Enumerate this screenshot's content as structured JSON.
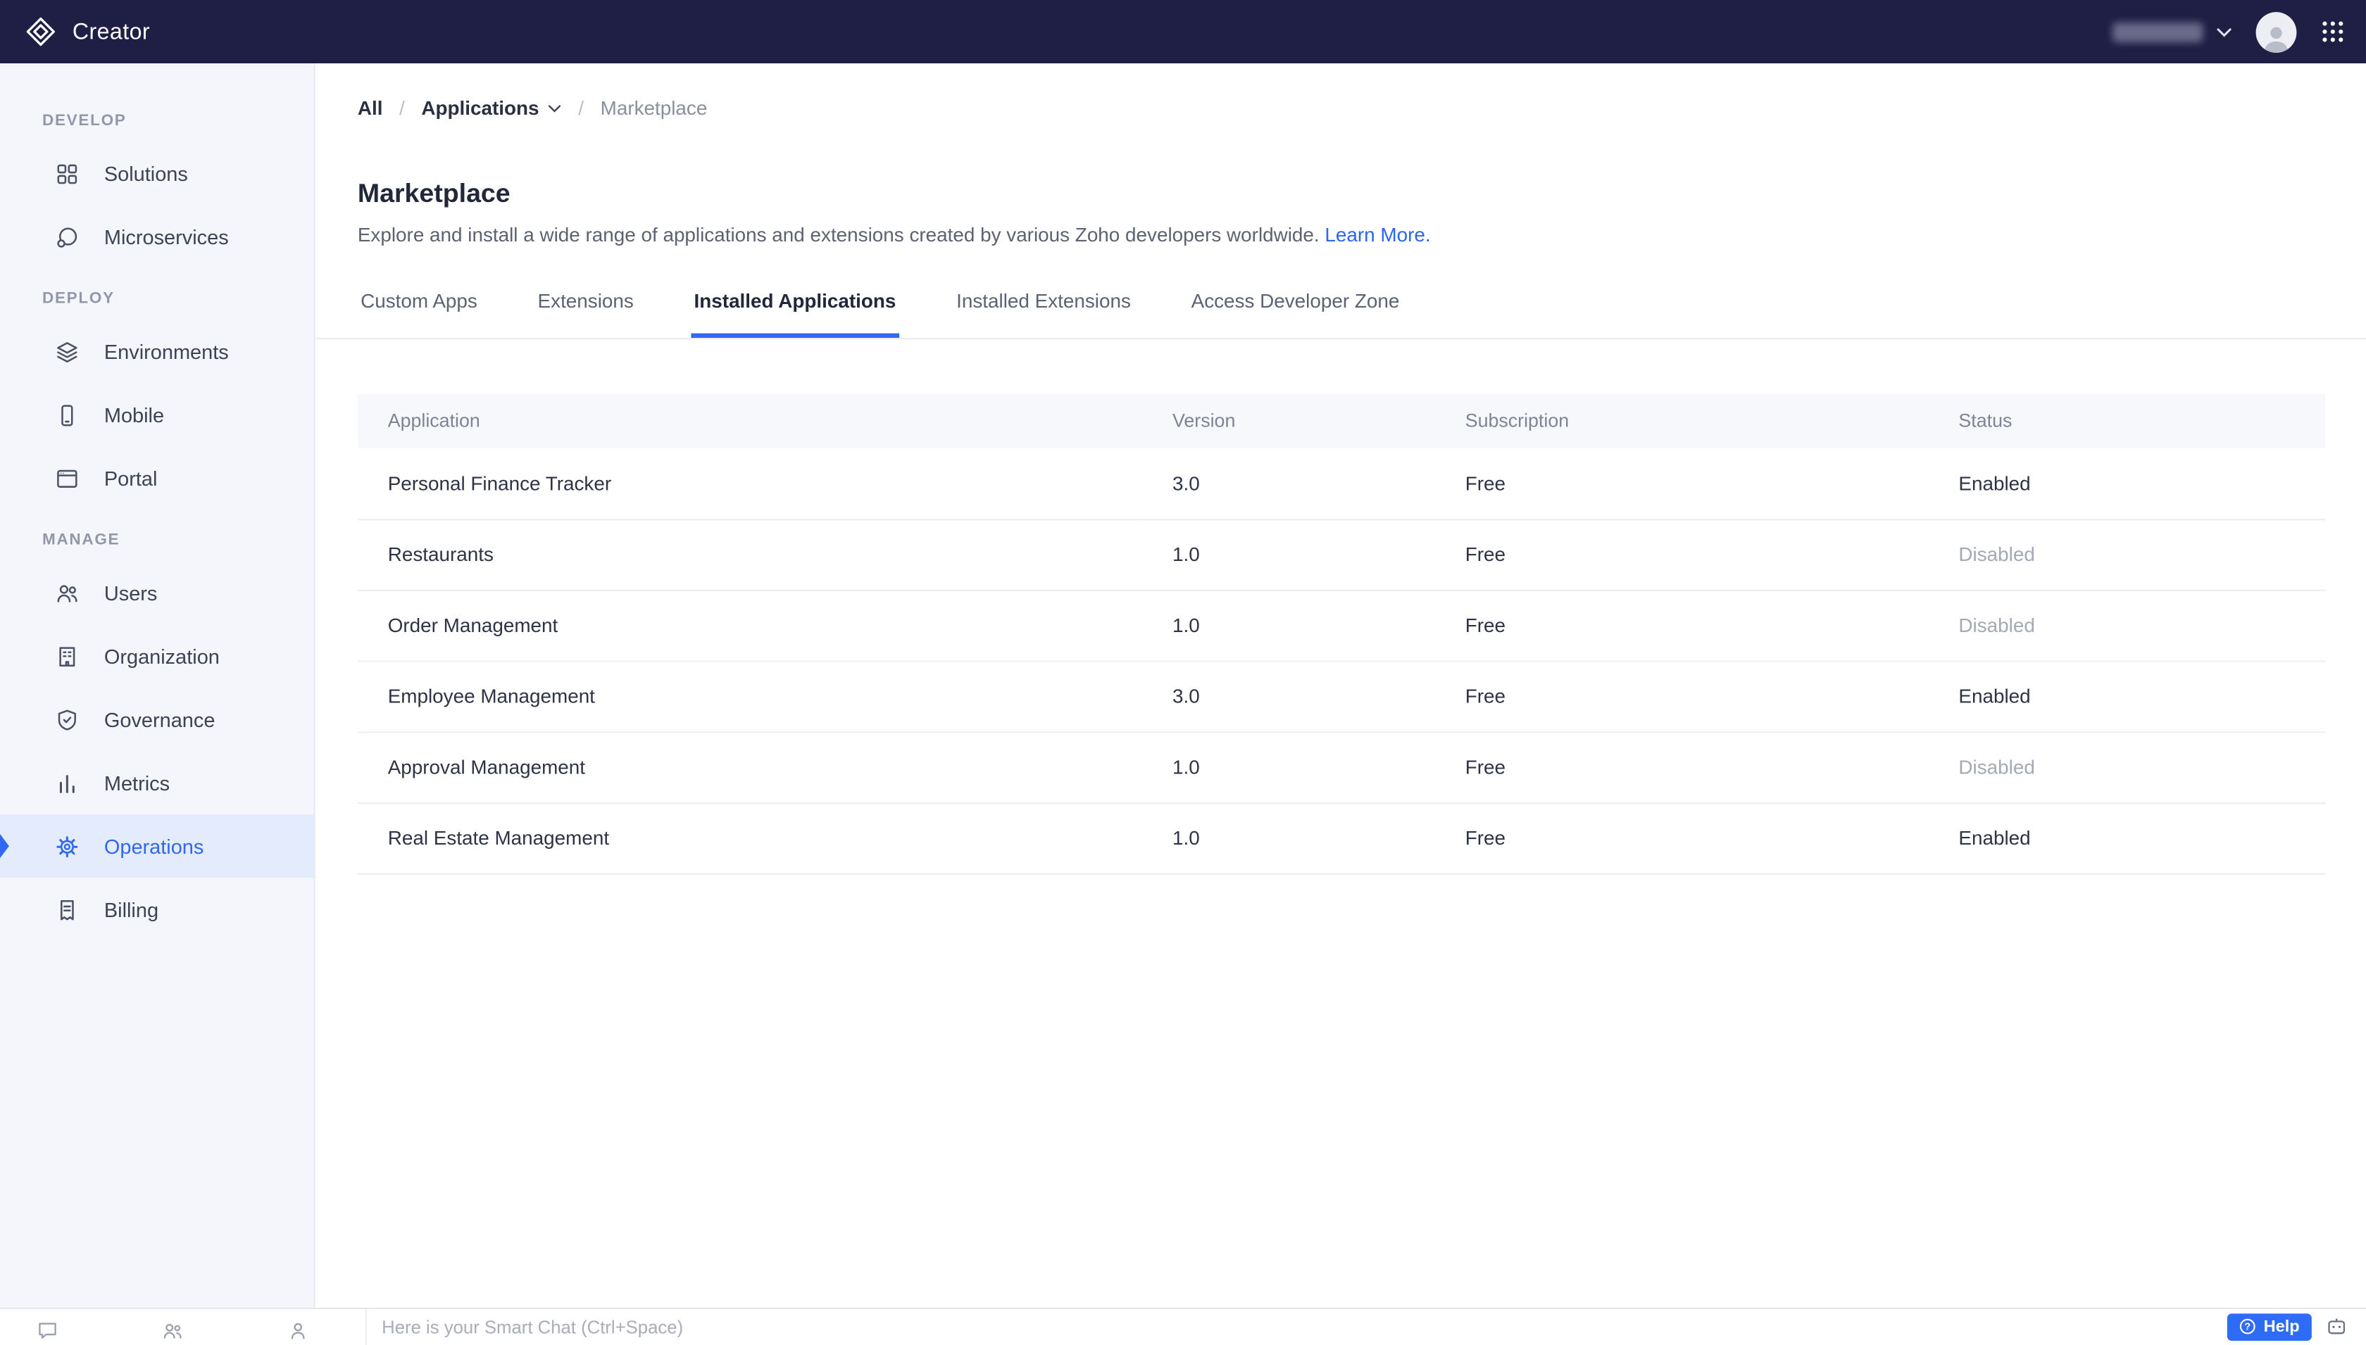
{
  "topbar": {
    "app_name": "Creator"
  },
  "sidebar": {
    "sections": [
      {
        "label": "DEVELOP",
        "items": [
          {
            "label": "Solutions"
          },
          {
            "label": "Microservices"
          }
        ]
      },
      {
        "label": "DEPLOY",
        "items": [
          {
            "label": "Environments"
          },
          {
            "label": "Mobile"
          },
          {
            "label": "Portal"
          }
        ]
      },
      {
        "label": "MANAGE",
        "items": [
          {
            "label": "Users"
          },
          {
            "label": "Organization"
          },
          {
            "label": "Governance"
          },
          {
            "label": "Metrics"
          },
          {
            "label": "Operations",
            "active": true
          },
          {
            "label": "Billing"
          }
        ]
      }
    ]
  },
  "breadcrumb": {
    "items": [
      "All",
      "Applications",
      "Marketplace"
    ],
    "separator": "/"
  },
  "page": {
    "title": "Marketplace",
    "description": "Explore and install a wide range of applications and extensions created by various Zoho developers worldwide.",
    "learn_more": "Learn More."
  },
  "tabs": [
    {
      "label": "Custom Apps"
    },
    {
      "label": "Extensions"
    },
    {
      "label": "Installed Applications",
      "active": true
    },
    {
      "label": "Installed Extensions"
    },
    {
      "label": "Access Developer Zone"
    }
  ],
  "table": {
    "columns": [
      "Application",
      "Version",
      "Subscription",
      "Status"
    ],
    "rows": [
      {
        "application": "Personal Finance Tracker",
        "version": "3.0",
        "subscription": "Free",
        "status": "Enabled"
      },
      {
        "application": "Restaurants",
        "version": "1.0",
        "subscription": "Free",
        "status": "Disabled"
      },
      {
        "application": "Order Management",
        "version": "1.0",
        "subscription": "Free",
        "status": "Disabled"
      },
      {
        "application": "Employee Management",
        "version": "3.0",
        "subscription": "Free",
        "status": "Enabled"
      },
      {
        "application": "Approval Management",
        "version": "1.0",
        "subscription": "Free",
        "status": "Disabled"
      },
      {
        "application": "Real Estate Management",
        "version": "1.0",
        "subscription": "Free",
        "status": "Enabled"
      }
    ]
  },
  "bottombar": {
    "chat_placeholder": "Here is your Smart Chat (Ctrl+Space)",
    "help_label": "Help"
  },
  "icons": {
    "help_glyph": "?"
  },
  "colors": {
    "accent": "#3168f2",
    "topbar": "#1f1e45",
    "link": "#2a66f5"
  }
}
